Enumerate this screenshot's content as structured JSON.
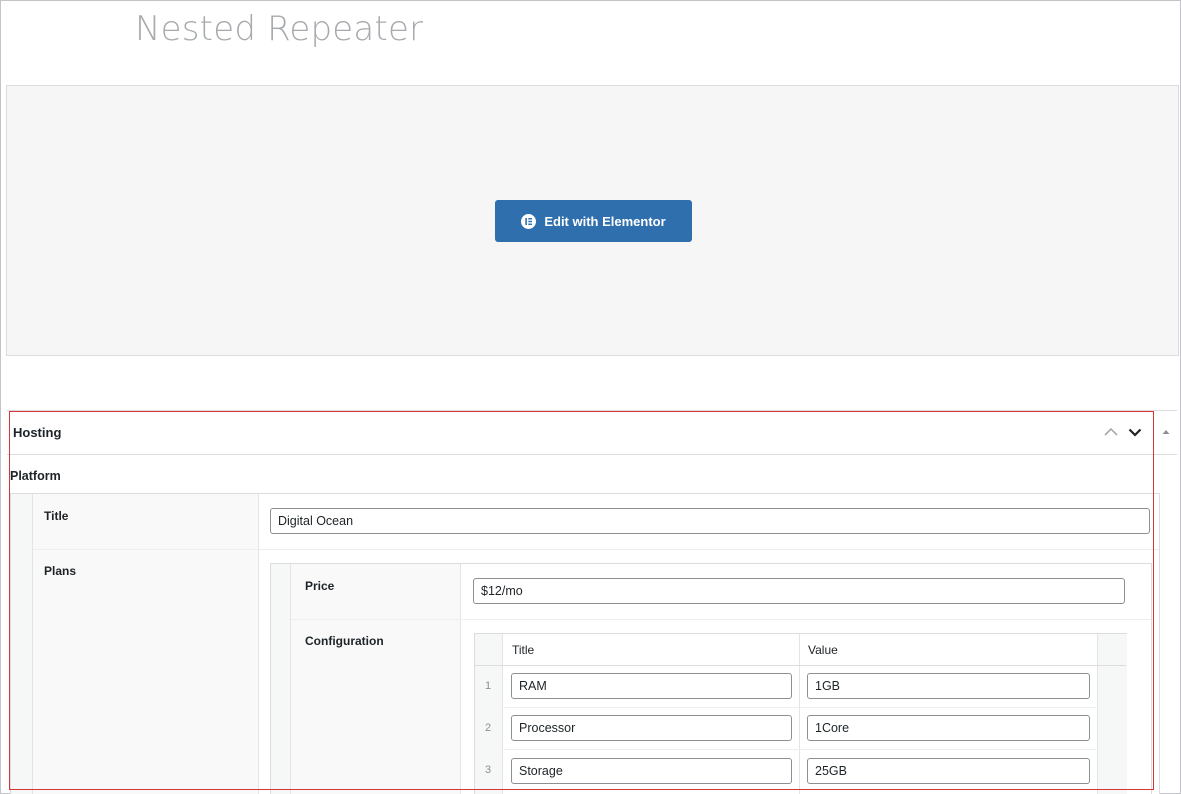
{
  "page": {
    "title": "Nested Repeater"
  },
  "editor": {
    "button_label": "Edit with Elementor"
  },
  "metabox": {
    "title": "Hosting"
  },
  "platform": {
    "label": "Platform",
    "title_label": "Title",
    "title_value": "Digital Ocean",
    "plans_label": "Plans",
    "plans": {
      "price_label": "Price",
      "price_value": "$12/mo",
      "config_label": "Configuration",
      "table": {
        "headers": [
          "Title",
          "Value"
        ],
        "rows": [
          {
            "index": "1",
            "title": "RAM",
            "value": "1GB"
          },
          {
            "index": "2",
            "title": "Processor",
            "value": "1Core"
          },
          {
            "index": "3",
            "title": "Storage",
            "value": "25GB"
          }
        ]
      }
    }
  },
  "colors": {
    "button": "#2f6fae",
    "highlight": "#d63638",
    "title": "#a7aaad"
  },
  "icons": {
    "elementor": "elementor-logo-icon",
    "move_up": "chevron-up-icon",
    "move_down": "chevron-down-icon",
    "toggle": "triangle-up-icon"
  }
}
